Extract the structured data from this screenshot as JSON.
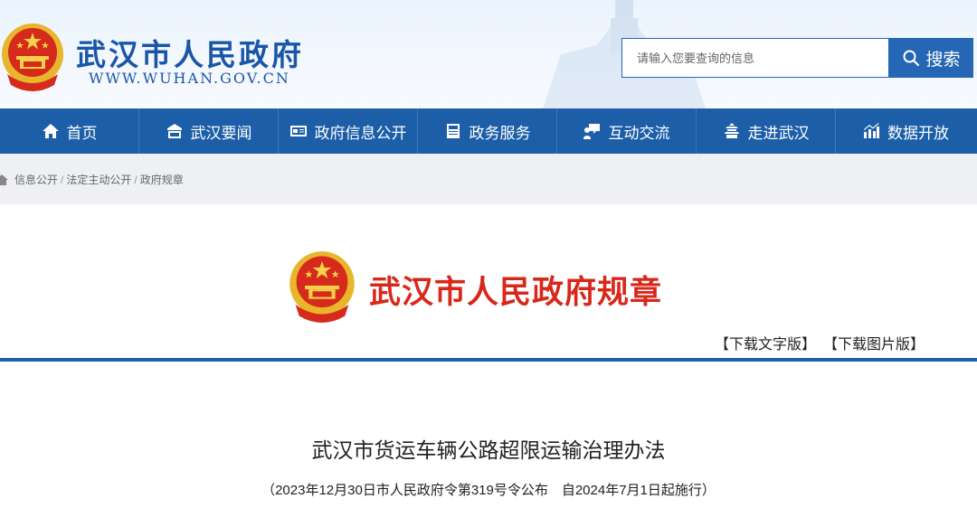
{
  "header": {
    "site_title": "武汉市人民政府",
    "site_url": "WWW.WUHAN.GOV.CN",
    "search_placeholder": "请输入您要查询的信息",
    "search_label": "搜索"
  },
  "nav": {
    "items": [
      {
        "label": "首页",
        "icon": "home-icon"
      },
      {
        "label": "武汉要闻",
        "icon": "news-icon"
      },
      {
        "label": "政府信息公开",
        "icon": "id-card-icon"
      },
      {
        "label": "政务服务",
        "icon": "document-icon"
      },
      {
        "label": "互动交流",
        "icon": "chat-user-icon"
      },
      {
        "label": "走进武汉",
        "icon": "landmark-icon"
      },
      {
        "label": "数据开放",
        "icon": "bar-chart-icon"
      }
    ]
  },
  "breadcrumb": {
    "items": [
      "信息公开",
      "法定主动公开",
      "政府规章"
    ],
    "separator": "/"
  },
  "content": {
    "rule_title": "武汉市人民政府规章",
    "download_text": "【下载文字版】",
    "download_image": "【下载图片版】",
    "doc_title": "武汉市货运车辆公路超限运输治理办法",
    "doc_subtitle": "（2023年12月30日市人民政府令第319号令公布　自2024年7月1日起施行）"
  },
  "colors": {
    "primary_blue": "#1c5ea8",
    "title_red": "#d8281c",
    "crumb_bg": "#eef0f4"
  }
}
